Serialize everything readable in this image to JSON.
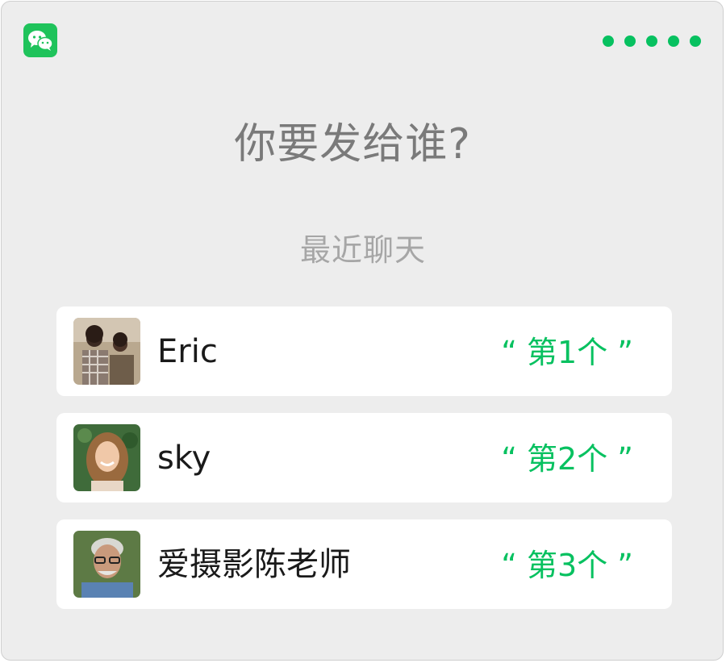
{
  "app": {
    "icon": "wechat-icon",
    "menu_icon": "more-dots-icon",
    "accent_color": "#07c160"
  },
  "header": {
    "title": "你要发给谁?",
    "subtitle": "最近聊天"
  },
  "contacts": [
    {
      "name": "Eric",
      "order": "“ 第1个 ”",
      "avatar": "group-photo-avatar"
    },
    {
      "name": "sky",
      "order": "“ 第2个 ”",
      "avatar": "woman-portrait-avatar"
    },
    {
      "name": "爱摄影陈老师",
      "order": "“ 第3个 ”",
      "avatar": "man-with-glasses-avatar"
    }
  ]
}
